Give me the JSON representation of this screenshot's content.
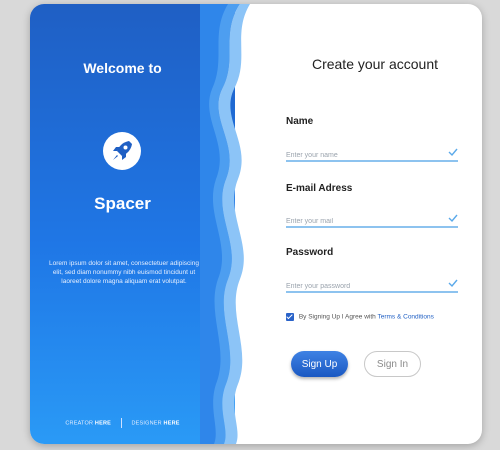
{
  "left_panel": {
    "welcome": "Welcome to",
    "brand": "Spacer",
    "logo_icon": "rocket-icon",
    "description": "Lorem ipsum dolor sit amet, consectetuer adipiscing elit, sed diam nonummy nibh euismod tincidunt ut laoreet dolore magna aliquam erat volutpat.",
    "credits": {
      "creator_label": "CREATOR",
      "creator_value": "HERE",
      "designer_label": "DESIGNER",
      "designer_value": "HERE"
    }
  },
  "form": {
    "title": "Create your account",
    "fields": [
      {
        "label": "Name",
        "placeholder": "Enter your name"
      },
      {
        "label": "E-mail Adress",
        "placeholder": "Enter your mail"
      },
      {
        "label": "Password",
        "placeholder": "Enter your password"
      }
    ],
    "agree_text": "By Signing Up I Agree with",
    "terms_link": "Terms & Conditions",
    "agree_checked": true,
    "signup_label": "Sign Up",
    "signin_label": "Sign In"
  },
  "colors": {
    "primary": "#1f5fc4",
    "accent": "#2a9af6",
    "underline": "#8dc3ef"
  }
}
